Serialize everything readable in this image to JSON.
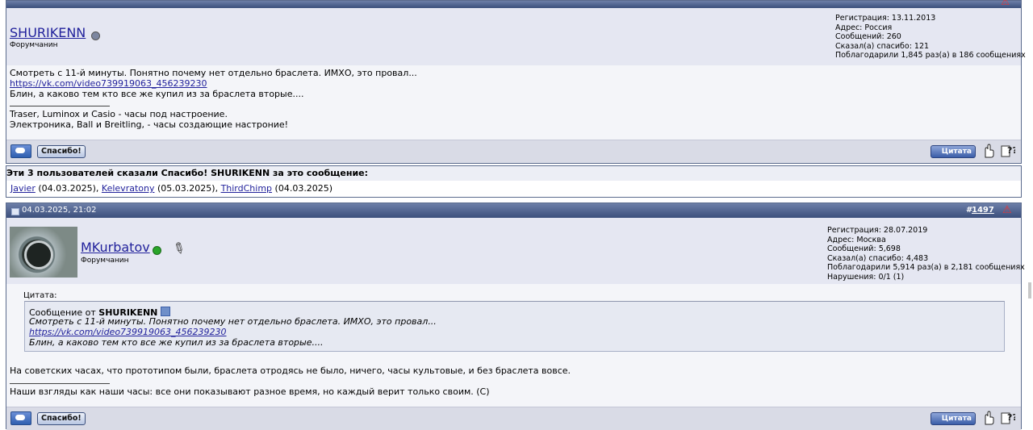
{
  "post1": {
    "username": "SHURIKENN",
    "user_title": "Форумчанин",
    "info": [
      "Регистрация: 13.11.2013",
      "Адрес: Россия",
      "Сообщений: 260",
      "Сказал(а) спасибо: 121",
      "Поблагодарили 1,845 раз(а) в 186 сообщениях"
    ],
    "lines": [
      "Смотреть с 11-й минуты. Понятно почему нет отдельно браслета. ИМХО, это провал...",
      "https://vk.com/video739919063_456239230",
      "Блин, а каково тем кто все же купил из за браслета вторые...."
    ],
    "signature": [
      "Traser, Luminox и Casio - часы под настроение.",
      "Электроника, Ball и Breitling, - часы создающие настроние!"
    ],
    "thanks_button": "Спасибо!",
    "quote_button": "Цитата"
  },
  "thanks": {
    "header": "Эти 3 пользователей сказали Спасибо! SHURIKENN за это сообщение:",
    "users": [
      {
        "name": "Javier",
        "date": "(04.03.2025)"
      },
      {
        "name": "Kelevratony",
        "date": "(05.03.2025)"
      },
      {
        "name": "ThirdChimp",
        "date": "(04.03.2025)"
      }
    ]
  },
  "post2": {
    "datetime": "04.03.2025, 21:02",
    "post_number_prefix": "#",
    "post_number": "1497",
    "username": "MKurbatov",
    "user_title": "Форумчанин",
    "info": [
      "Регистрация: 28.07.2019",
      "Адрес: Москва",
      "Сообщений: 5,698",
      "Сказал(а) спасибо: 4,483",
      "Поблагодарили 5,914 раз(а) в 2,181 сообщениях",
      "Нарушения: 0/1 (1)"
    ],
    "quote_label": "Цитата:",
    "quote_from_prefix": "Сообщение от",
    "quote_author": "SHURIKENN",
    "quote_lines": [
      "Смотреть с 11-й минуты. Понятно почему нет отдельно браслета. ИМХО, это провал...",
      "https://vk.com/video739919063_456239230",
      "Блин, а каково тем кто все же купил из за браслета вторые...."
    ],
    "text": "На советских часах, что прототипом были, браслета отродясь не было, ничего, часы культовые, и без браслета вовсе.",
    "signature": "Наши взгляды как наши часы: все они показывают разное время, но каждый верит только своим. (С)",
    "thanks_button": "Спасибо!",
    "quote_button": "Цитата"
  },
  "colors": {
    "header": "#3b4f7c",
    "userbar": "#e5e7f2",
    "link": "#22229c",
    "online": "#2aa52a",
    "offline": "#7c86a0"
  }
}
